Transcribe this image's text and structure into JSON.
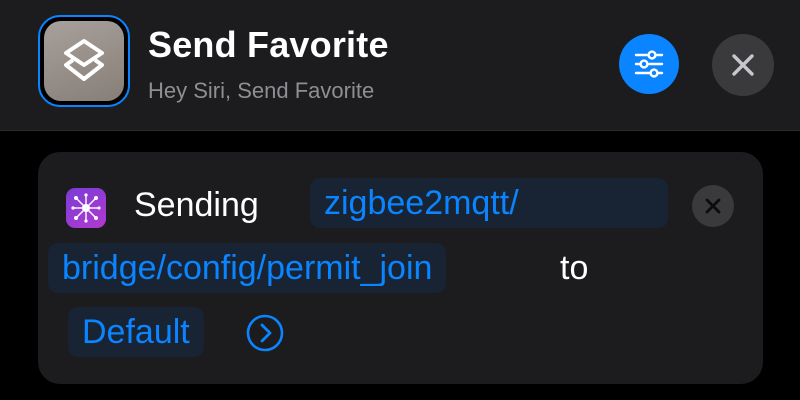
{
  "header": {
    "title": "Send Favorite",
    "subtitle": "Hey Siri, Send Favorite",
    "app_icon": "shortcuts-layers-icon",
    "settings_icon": "sliders-icon",
    "close_icon": "close-icon"
  },
  "action": {
    "icon": "network-hub-icon",
    "verb": "Sending",
    "topic_line1": "zigbee2mqtt/",
    "topic_line2": "bridge/config/permit_join",
    "connector": "to",
    "target": "Default",
    "remove_icon": "close-icon",
    "expand_icon": "chevron-right-circle-icon"
  },
  "colors": {
    "background": "#000000",
    "surface": "#1c1c1e",
    "accent": "#0a84ff",
    "token_bg": "#182433",
    "secondary_text": "#8e8e93",
    "button_gray": "#3a3a3c"
  }
}
